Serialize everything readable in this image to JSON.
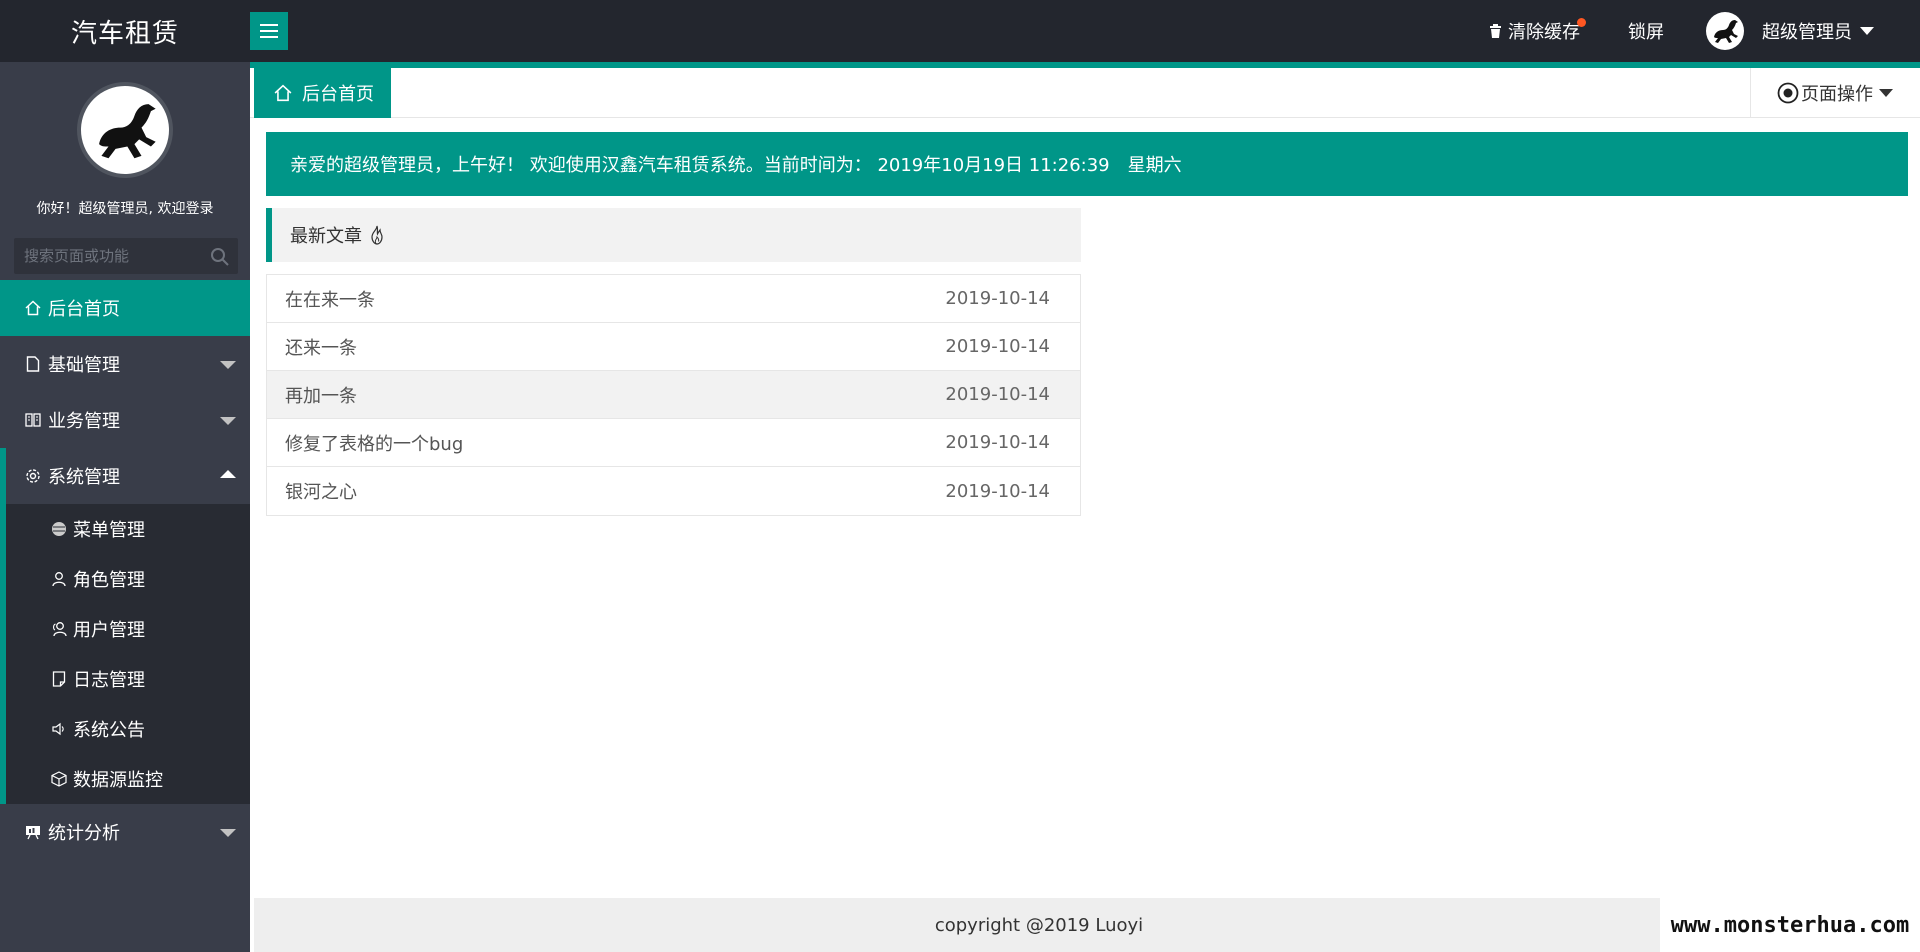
{
  "header": {
    "logo": "汽车租赁",
    "clear_cache": "清除缓存",
    "lock_screen": "锁屏",
    "user_name": "超级管理员"
  },
  "sidebar": {
    "welcome": "你好！超级管理员, 欢迎登录",
    "search_placeholder": "搜索页面或功能",
    "items": [
      {
        "label": "后台首页",
        "icon": "home-icon",
        "state": "active"
      },
      {
        "label": "基础管理",
        "icon": "file-icon",
        "state": "collapsed"
      },
      {
        "label": "业务管理",
        "icon": "book-icon",
        "state": "collapsed"
      },
      {
        "label": "系统管理",
        "icon": "gear-icon",
        "state": "expanded"
      },
      {
        "label": "统计分析",
        "icon": "chart-board-icon",
        "state": "collapsed"
      }
    ],
    "system_sub": [
      {
        "label": "菜单管理",
        "icon": "circle-icon"
      },
      {
        "label": "角色管理",
        "icon": "person-icon"
      },
      {
        "label": "用户管理",
        "icon": "user-group-icon"
      },
      {
        "label": "日志管理",
        "icon": "note-icon"
      },
      {
        "label": "系统公告",
        "icon": "speaker-icon"
      },
      {
        "label": "数据源监控",
        "icon": "cube-icon"
      }
    ]
  },
  "tabs": {
    "home": "后台首页",
    "page_ops": "页面操作"
  },
  "main": {
    "banner": "亲爱的超级管理员，上午好！ 欢迎使用汉鑫汽车租赁系统。当前时间为： 2019年10月19日 11:26:39　星期六",
    "articles_title": "最新文章",
    "articles": [
      {
        "title": "在在来一条",
        "date": "2019-10-14"
      },
      {
        "title": "还来一条",
        "date": "2019-10-14"
      },
      {
        "title": "再加一条",
        "date": "2019-10-14"
      },
      {
        "title": "修复了表格的一个bug",
        "date": "2019-10-14"
      },
      {
        "title": "银河之心",
        "date": "2019-10-14"
      }
    ]
  },
  "footer": {
    "copyright": "copyright @2019 Luoyi"
  },
  "watermark": "www.monsterhua.com",
  "colors": {
    "accent": "#009688",
    "header_bg": "#23262e",
    "sidebar_bg": "#393d49",
    "subnav_bg": "#282b33",
    "badge_dot": "#ff5722"
  }
}
